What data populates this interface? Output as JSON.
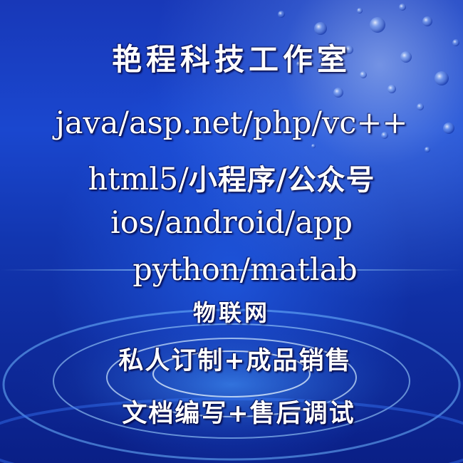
{
  "banner": {
    "title": "艳程科技工作室",
    "line2": "java/asp.net/php/vc++",
    "line3_latin": "html5/",
    "line3_cn": "小程序/公众号",
    "line4": "ios/android/app",
    "line5": "python/matlab",
    "line6": "物联网",
    "line7": "私人订制+成品销售",
    "line8": "文档编写+售后调试"
  },
  "colors": {
    "text": "#ffffff",
    "bg_top": "#1838b8",
    "bg_bottom": "#0a1f86"
  }
}
